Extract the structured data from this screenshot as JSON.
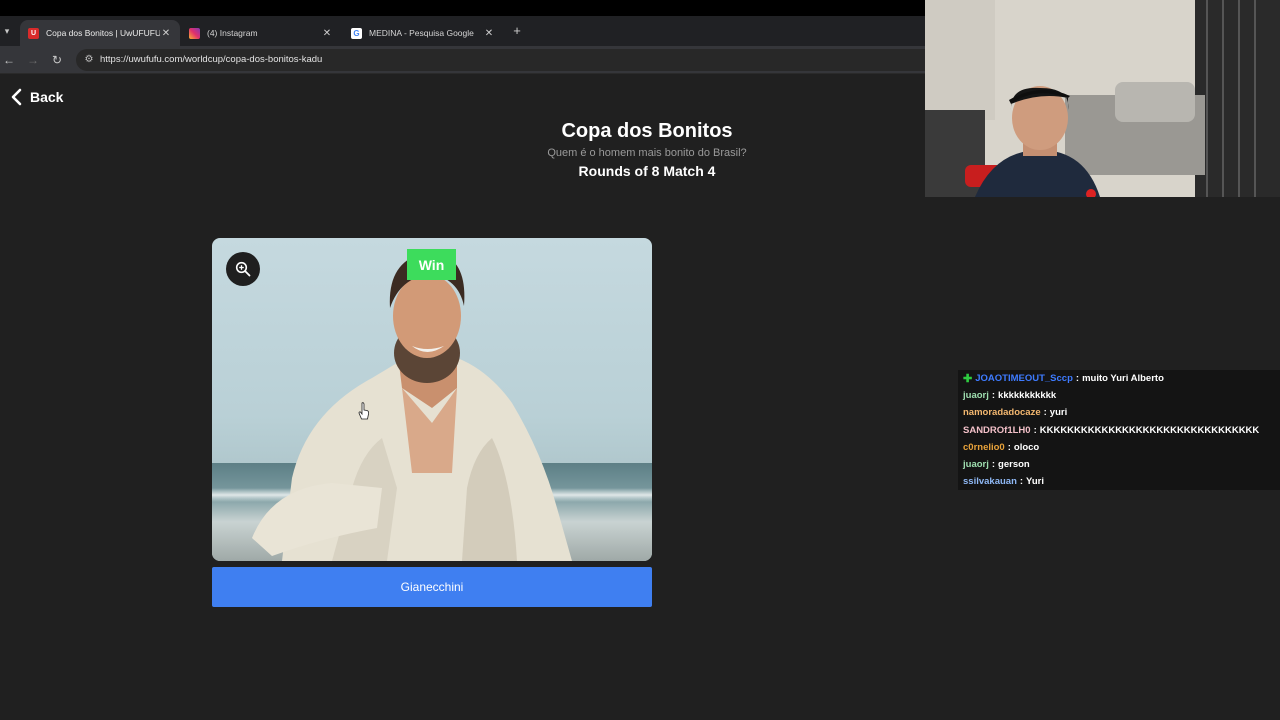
{
  "browser": {
    "tabs": [
      {
        "title": "Copa dos Bonitos | UwUFUFU",
        "favicon": "U",
        "active": true
      },
      {
        "title": "(4) Instagram",
        "favicon": "",
        "active": false
      },
      {
        "title": "MEDINA - Pesquisa Google",
        "favicon": "G",
        "active": false
      }
    ],
    "url": "https://uwufufu.com/worldcup/copa-dos-bonitos-kadu"
  },
  "page": {
    "back_label": "Back",
    "title": "Copa dos Bonitos",
    "subtitle": "Quem é o homem mais bonito do Brasil?",
    "round": "Rounds of 8 Match 4",
    "badge": "Win",
    "choice_label": "Gianecchini"
  },
  "chat": {
    "messages": [
      {
        "user": "JOAOTIMEOUT_Sccp",
        "text": "muito Yuri Alberto",
        "color": "#3e7bff",
        "mod": true
      },
      {
        "user": "juaorj",
        "text": "kkkkkkkkkkk",
        "color": "#9fdfb0",
        "mod": false
      },
      {
        "user": "namoradadocaze",
        "text": "yuri",
        "color": "#f4b870",
        "mod": false
      },
      {
        "user": "SANDROf1LH0",
        "text": "KKKKKKKKKKKKKKKKKKKKKKKKKKKKKKKK",
        "color": "#f2c0c8",
        "mod": false
      },
      {
        "user": "c0rnelio0",
        "text": "oloco",
        "color": "#e8a23a",
        "mod": false
      },
      {
        "user": "juaorj",
        "text": "gerson",
        "color": "#9fdfb0",
        "mod": false
      },
      {
        "user": "ssilvakauan",
        "text": "Yuri",
        "color": "#8fb8f5",
        "mod": false
      }
    ]
  },
  "colors": {
    "background": "#202020",
    "win": "#3ddc5c",
    "button": "#3f7ff1"
  }
}
